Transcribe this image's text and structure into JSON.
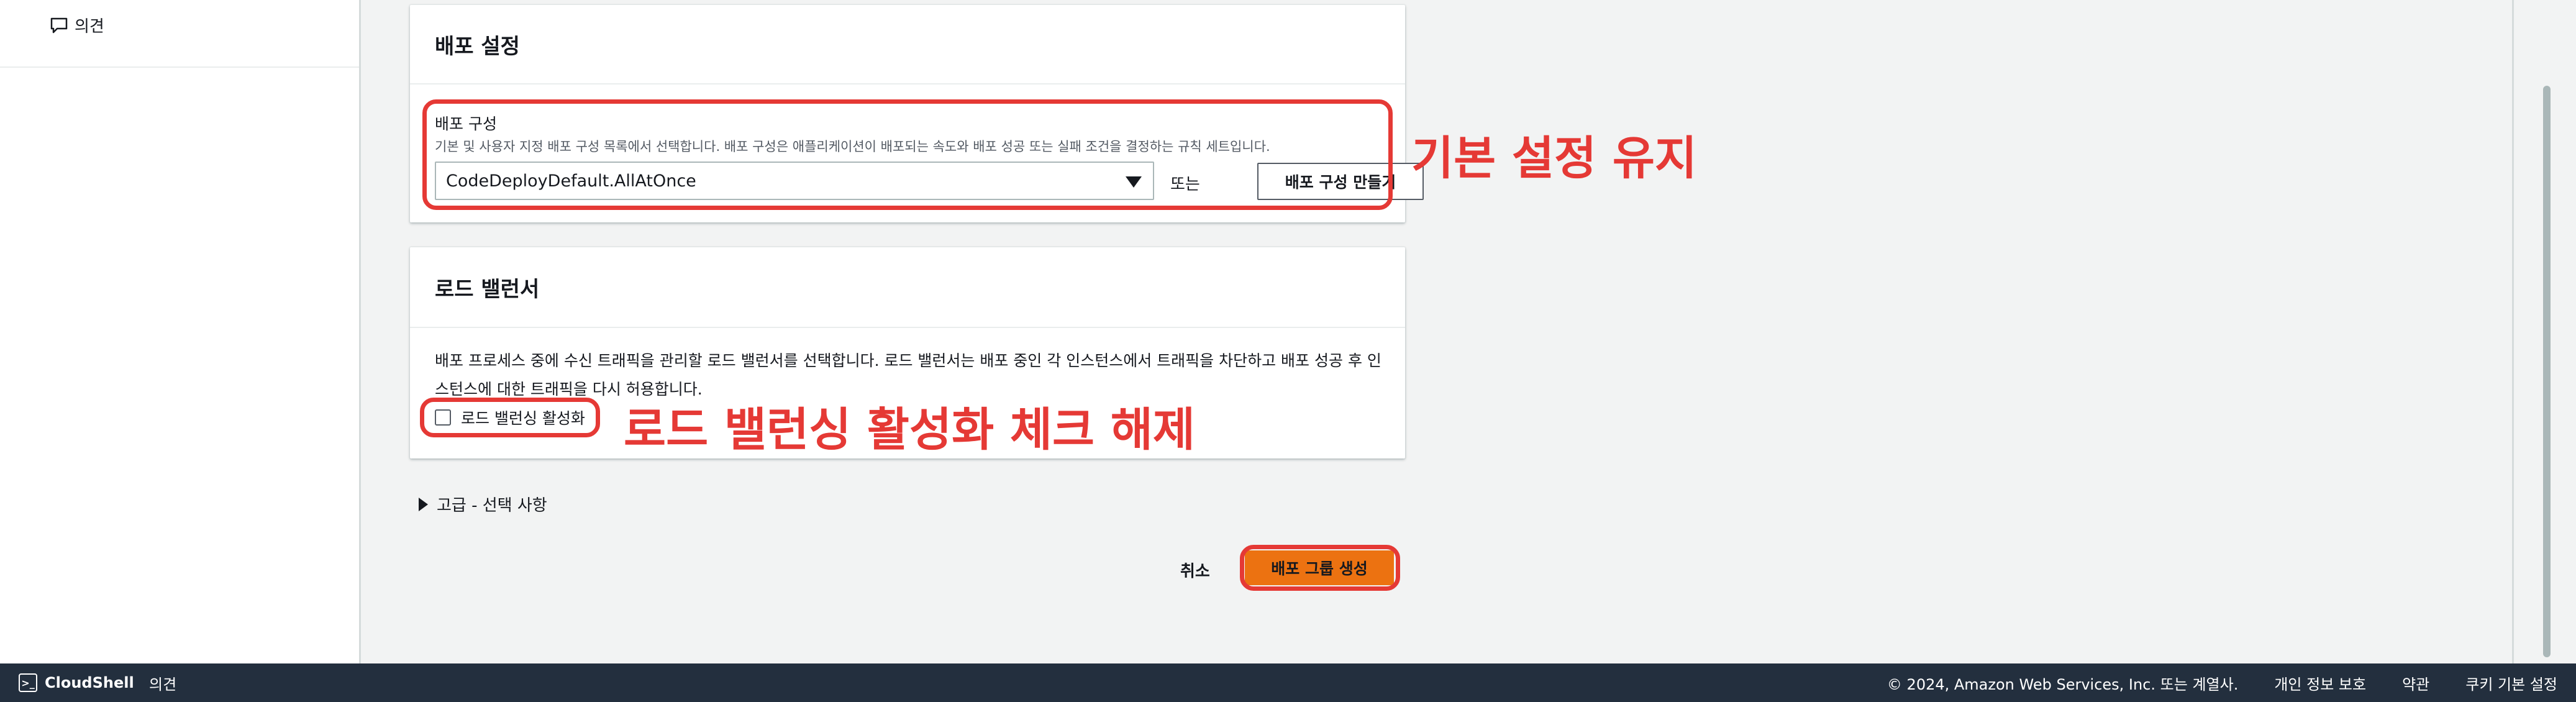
{
  "sidebar": {
    "feedback_label": "의견"
  },
  "deploy_settings": {
    "title": "배포 설정",
    "config_label": "배포 구성",
    "config_description": "기본 및 사용자 지정 배포 구성 목록에서 선택합니다. 배포 구성은 애플리케이션이 배포되는 속도와 배포 성공 또는 실패 조건을 결정하는 규칙 세트입니다.",
    "config_selected": "CodeDeployDefault.AllAtOnce",
    "or_text": "또는",
    "create_config_button": "배포 구성 만들기",
    "annotation": "기본 설정 유지"
  },
  "load_balancer": {
    "title": "로드 밸런서",
    "description": "배포 프로세스 중에 수신 트래픽을 관리할 로드 밸런서를 선택합니다. 로드 밸런서는 배포 중인 각 인스턴스에서 트래픽을 차단하고 배포 성공 후 인스턴스에 대한 트래픽을 다시 허용합니다.",
    "checkbox_label": "로드 밸런싱 활성화",
    "checkbox_checked": false,
    "annotation": "로드 밸런싱 활성화 체크 해제"
  },
  "advanced": {
    "label": "고급 - 선택 사항"
  },
  "actions": {
    "cancel": "취소",
    "create": "배포 그룹 생성"
  },
  "footer": {
    "cloudshell": "CloudShell",
    "feedback": "의견",
    "copyright": "© 2024, Amazon Web Services, Inc. 또는 계열사.",
    "privacy": "개인 정보 보호",
    "terms": "약관",
    "cookies": "쿠키 기본 설정"
  },
  "colors": {
    "annotation_red": "#e53935",
    "primary_orange": "#ec7211",
    "footer_bg": "#232f3e"
  }
}
